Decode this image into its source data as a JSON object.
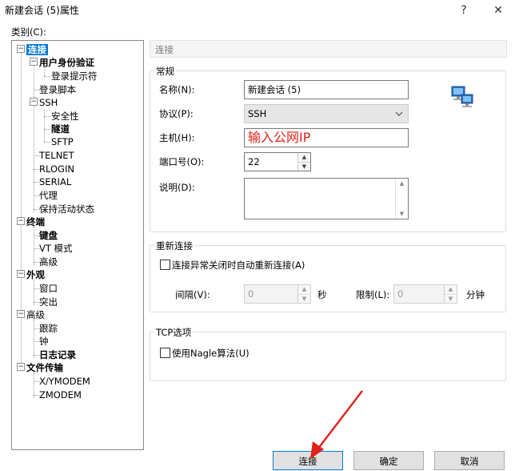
{
  "window": {
    "title": "新建会话 (5)属性",
    "help_label": "?",
    "close_label": "✕"
  },
  "category_label": "类别(C):",
  "tree": {
    "n0": "连接",
    "n1": "用户身份验证",
    "n2": "登录提示符",
    "n3": "登录脚本",
    "n4": "SSH",
    "n5": "安全性",
    "n6": "隧道",
    "n7": "SFTP",
    "n8": "TELNET",
    "n9": "RLOGIN",
    "n10": "SERIAL",
    "n11": "代理",
    "n12": "保持活动状态",
    "n13": "终端",
    "n14": "键盘",
    "n15": "VT 模式",
    "n16": "高级",
    "n17": "外观",
    "n18": "窗口",
    "n19": "突出",
    "n20": "高级",
    "n21": "跟踪",
    "n22": "钟",
    "n23": "日志记录",
    "n24": "文件传输",
    "n25": "X/YMODEM",
    "n26": "ZMODEM",
    "expander_minus": "−"
  },
  "panel_header": "连接",
  "general": {
    "group_label": "常规",
    "name_label": "名称(N):",
    "name_value": "新建会话 (5)",
    "protocol_label": "协议(P):",
    "protocol_value": "SSH",
    "host_label": "主机(H):",
    "host_annotation": "输入公网IP",
    "port_label": "端口号(O):",
    "port_value": "22",
    "desc_label": "说明(D):"
  },
  "reconnect": {
    "group_label": "重新连接",
    "auto_reconnect_label": "连接异常关闭时自动重新连接(A)",
    "interval_label": "间隔(V):",
    "interval_value": "0",
    "interval_unit": "秒",
    "limit_label": "限制(L):",
    "limit_value": "0",
    "limit_unit": "分钟"
  },
  "tcp": {
    "group_label": "TCP选项",
    "nagle_label": "使用Nagle算法(U)"
  },
  "buttons": {
    "connect": "连接",
    "ok": "确定",
    "cancel": "取消"
  },
  "colors": {
    "annotation": "#e0201b",
    "selection": "#0078d7"
  }
}
